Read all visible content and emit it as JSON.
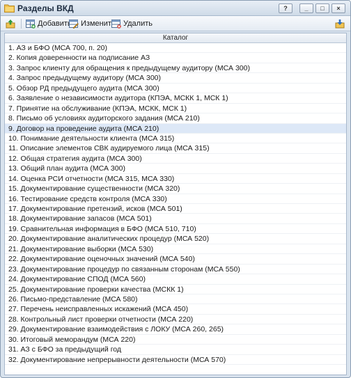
{
  "window": {
    "title": "Разделы ВКД",
    "help_label": "?",
    "minimize_label": "_",
    "maximize_label": "□",
    "close_label": "×"
  },
  "toolbar": {
    "add_label": "Добавить",
    "edit_label": "Изменить",
    "delete_label": "Удалить"
  },
  "grid": {
    "column_header": "Каталог",
    "selected_index": 8,
    "rows": [
      "1. АЗ и БФО (МСА 700, п. 20)",
      "2. Копия доверенности на подписание АЗ",
      "3. Запрос клиенту для обращения к предыдущему аудитору (МСА 300)",
      "4. Запрос предыдущему аудитору (МСА 300)",
      "5. Обзор РД предыдущего аудита (МСА 300)",
      "6. Заявление о независимости аудитора (КПЭА, МСКК 1, МСК 1)",
      "7. Принятие на обслуживание (КПЭА, МСКК, МСК 1)",
      "8. Письмо об условиях аудиторского задания (МСА 210)",
      "9. Договор на проведение аудита (МСА 210)",
      "10. Понимание деятельности клиента (МСА 315)",
      "11. Описание элементов СВК аудируемого лица (МСА 315)",
      "12. Общая стратегия аудита (МСА 300)",
      "13. Общий план аудита (МСА 300)",
      "14. Оценка РСИ отчетности (МСА 315, МСА 330)",
      "15. Документирование существенности (МСА 320)",
      "16. Тестирование средств контроля (МСА 330)",
      "17. Документирование претензий, исков (МСА 501)",
      "18. Документирование запасов (МСА 501)",
      "19. Сравнительная информация в БФО (МСА 510, 710)",
      "20. Документирование аналитических процедур (МСА 520)",
      "21. Документирование выборки (МСА 530)",
      "22. Документирование оценочных значений (МСА 540)",
      "23. Документирование процедур по связанным сторонам (МСА 550)",
      "24. Документирование СПОД (МСА 560)",
      "25. Документирование проверки качества (МСКК 1)",
      "26. Письмо-представление (МСА 580)",
      "27. Перечень неисправленных искажений (МСА 450)",
      "28. Контрольный лист проверки отчетности (МСА 220)",
      "29. Документирование взаимодействия с ЛОКУ (МСА 260, 265)",
      "30. Итоговый меморандум (МСА 220)",
      "31. АЗ с БФО за предыдущий год",
      "32. Документирование непрерывности деятельности (МСА 570)"
    ]
  }
}
